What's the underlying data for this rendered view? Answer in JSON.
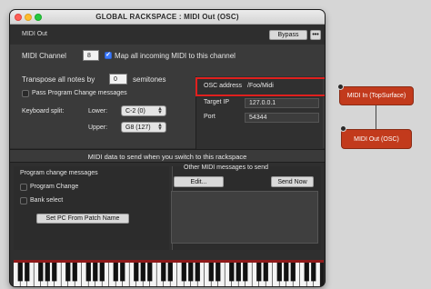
{
  "window": {
    "title": "GLOBAL RACKSPACE : MIDI Out (OSC)"
  },
  "toolbar": {
    "plugin_name": "MIDI Out",
    "bypass_label": "Bypass",
    "more_label": "•••"
  },
  "midi": {
    "channel_label": "MIDI Channel",
    "channel_value": "8",
    "map_all_label": "Map all incoming MIDI to this channel",
    "map_all_checked": true,
    "transpose_label": "Transpose all notes by",
    "transpose_value": "0",
    "semitones_label": "semitones",
    "pass_pc_label": "Pass Program Change messages",
    "keyboard_split_label": "Keyboard split:",
    "lower_label": "Lower:",
    "lower_value": "C-2 (0)",
    "upper_label": "Upper:",
    "upper_value": "G8 (127)"
  },
  "osc": {
    "address_label": "OSC address",
    "address_value": "/Foo/Midi",
    "target_ip_label": "Target IP",
    "target_ip_value": "127.0.0.1",
    "port_label": "Port",
    "port_value": "54344"
  },
  "band": {
    "title": "MIDI data to send when you switch to this rackspace"
  },
  "program_change": {
    "header": "Program change messages",
    "program_change_label": "Program Change",
    "bank_select_label": "Bank select",
    "set_pc_button": "Set PC From Patch Name"
  },
  "other_midi": {
    "header": "Other MIDI messages to send",
    "edit_button": "Edit...",
    "send_now_button": "Send Now"
  },
  "graph": {
    "node_in_label": "MIDI In (TopSurface)",
    "node_out_label": "MIDI Out (OSC)"
  },
  "colors": {
    "node_fill": "#c23a1c",
    "highlight_border": "#e0201e",
    "checkbox_on": "#3d7bff"
  }
}
